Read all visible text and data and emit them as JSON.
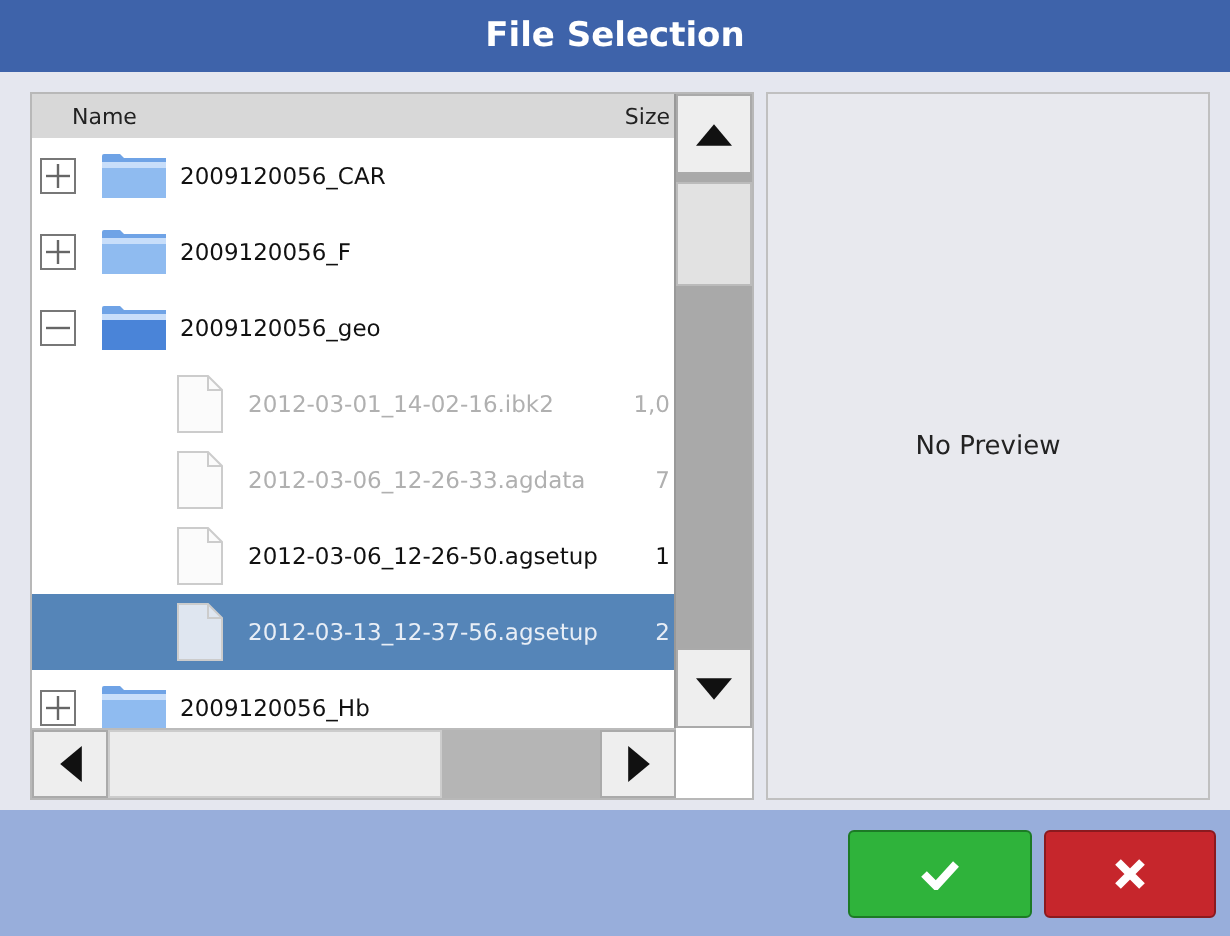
{
  "window": {
    "title": "File Selection"
  },
  "file_list": {
    "columns": [
      "Name",
      "Size"
    ],
    "items": [
      {
        "name": "2009120056_CAR",
        "kind": "folder",
        "expanded": false,
        "selected": false
      },
      {
        "name": "2009120056_F",
        "kind": "folder",
        "expanded": false,
        "selected": false
      },
      {
        "name": "2009120056_geo",
        "kind": "folder",
        "expanded": true,
        "selected": false,
        "children": [
          {
            "name": "2012-03-01_14-02-16.ibk2",
            "size": "1,0",
            "kind": "file",
            "disabled": true,
            "selected": false
          },
          {
            "name": "2012-03-06_12-26-33.agdata",
            "size": "7",
            "kind": "file",
            "disabled": true,
            "selected": false
          },
          {
            "name": "2012-03-06_12-26-50.agsetup",
            "size": "1",
            "kind": "file",
            "disabled": false,
            "selected": false
          },
          {
            "name": "2012-03-13_12-37-56.agsetup",
            "size": "2",
            "kind": "file",
            "disabled": false,
            "selected": true
          }
        ]
      },
      {
        "name": "2009120056_Hb",
        "kind": "folder",
        "expanded": false,
        "selected": false
      }
    ]
  },
  "preview": {
    "text": "No Preview"
  },
  "buttons": [
    {
      "kind": "confirm"
    },
    {
      "kind": "cancel"
    }
  ]
}
